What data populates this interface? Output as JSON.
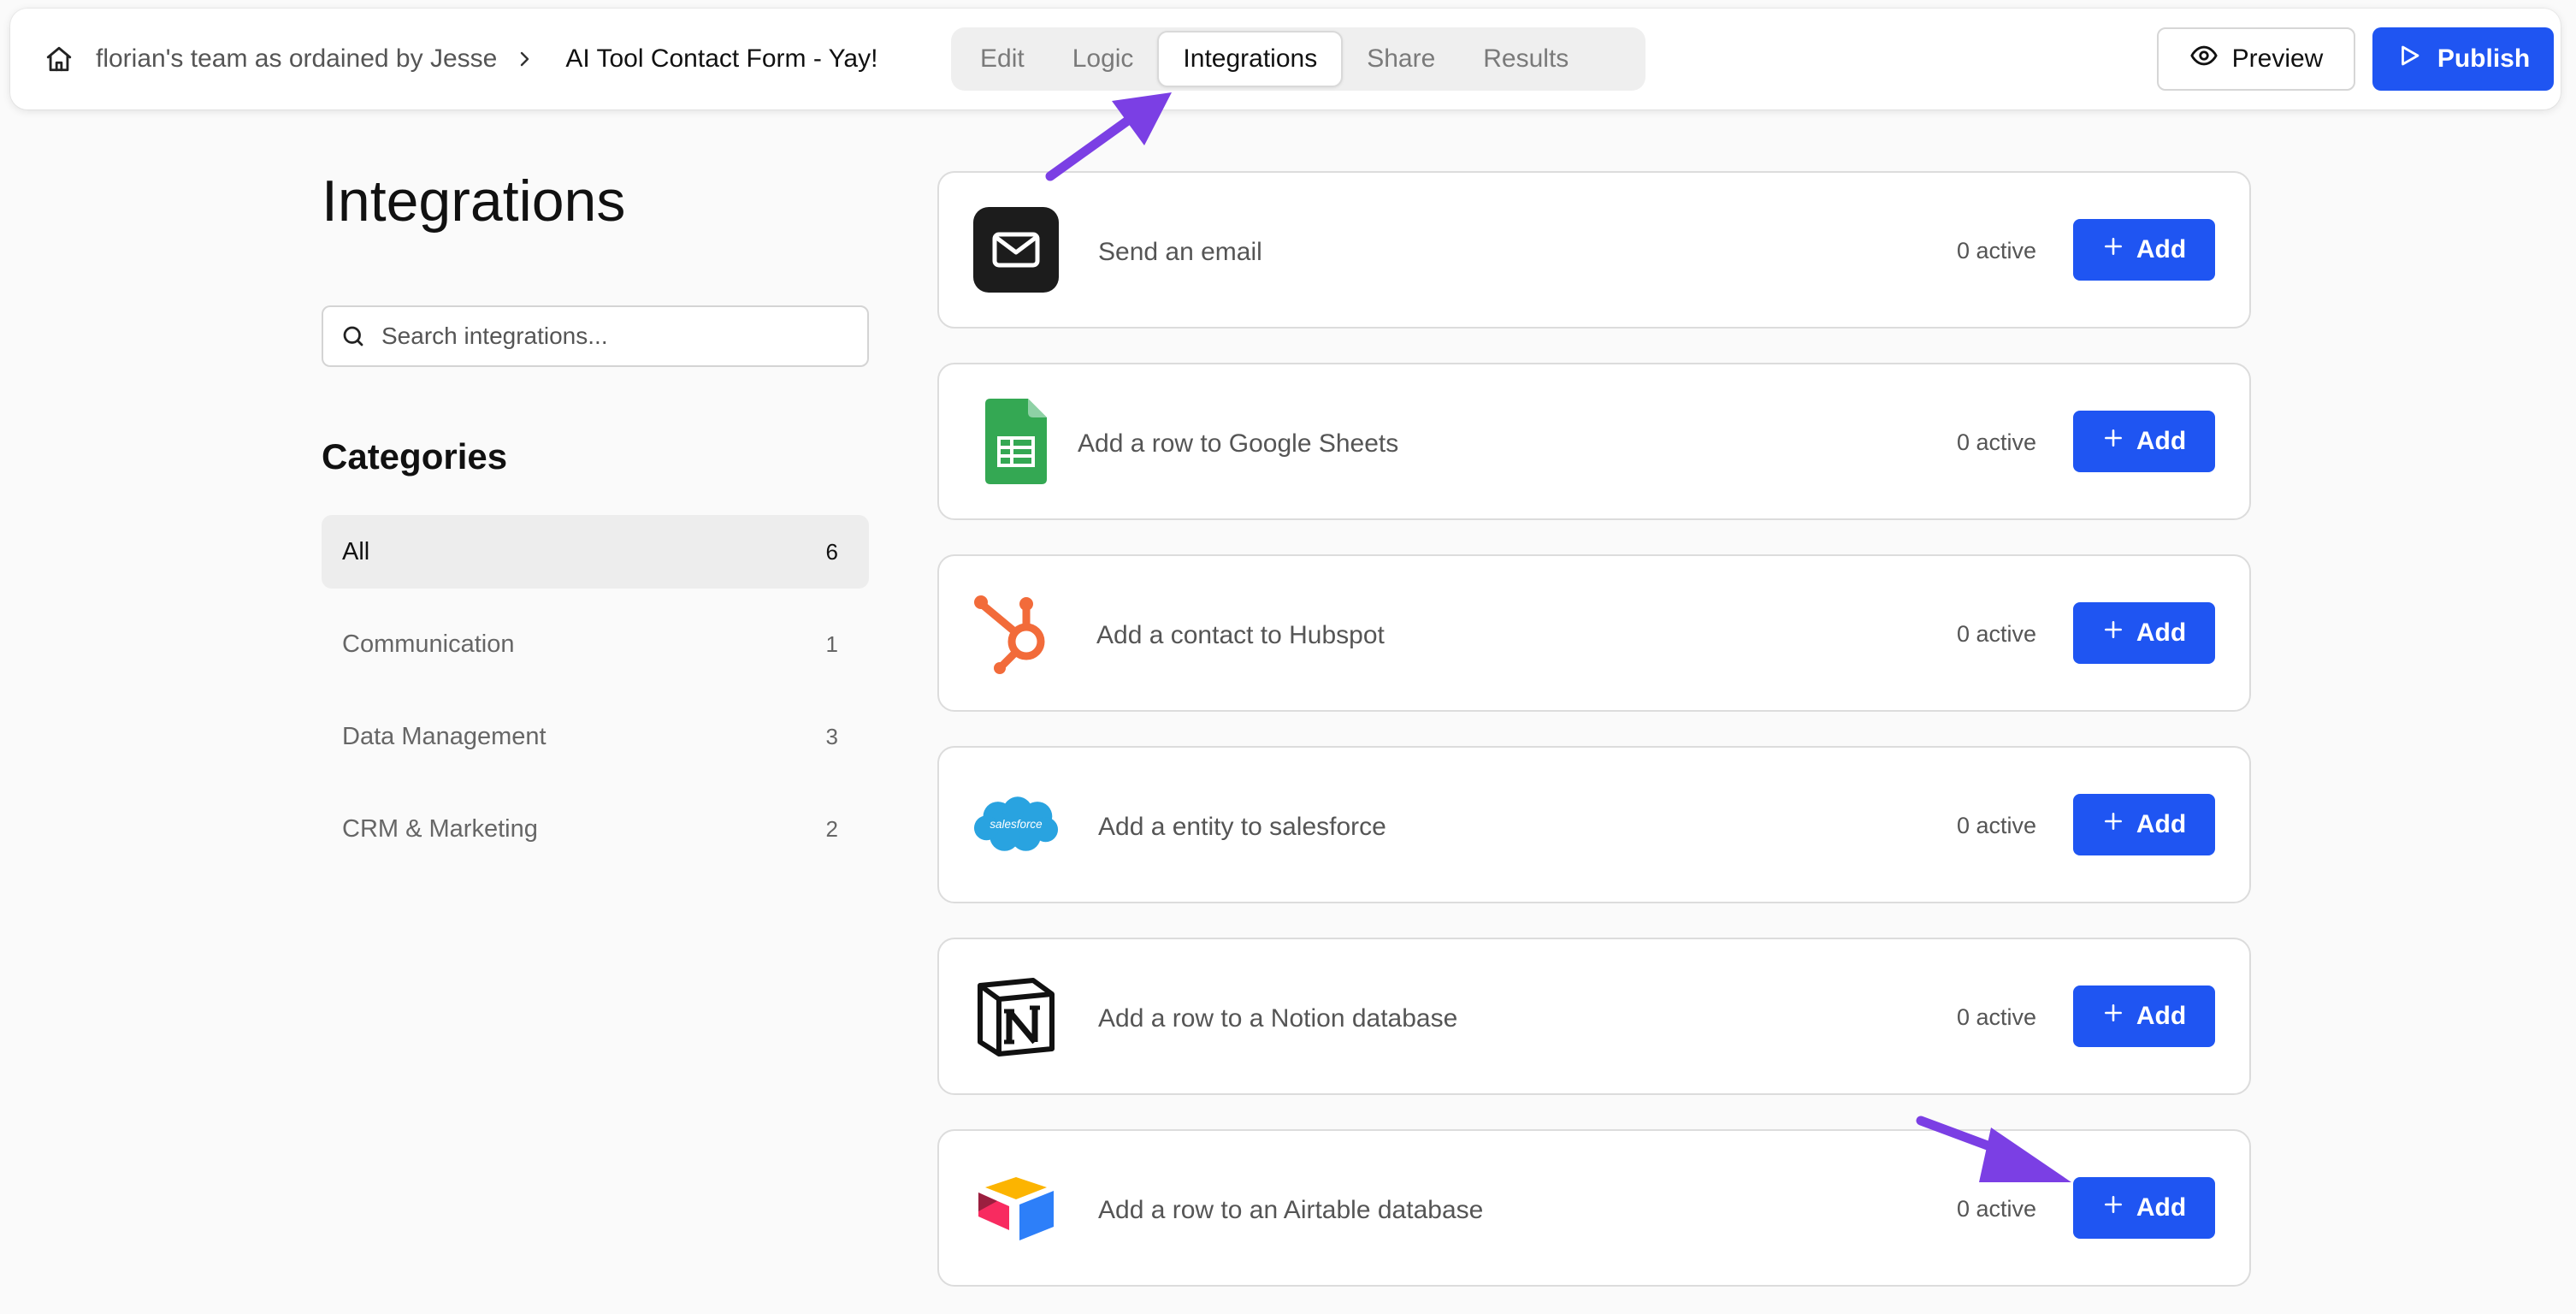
{
  "header": {
    "team_name": "florian's team as ordained by Jesse",
    "form_name": "AI Tool Contact Form - Yay!",
    "tabs": [
      {
        "label": "Edit",
        "active": false
      },
      {
        "label": "Logic",
        "active": false
      },
      {
        "label": "Integrations",
        "active": true
      },
      {
        "label": "Share",
        "active": false
      },
      {
        "label": "Results",
        "active": false
      }
    ],
    "preview_label": "Preview",
    "publish_label": "Publish"
  },
  "sidebar": {
    "title": "Integrations",
    "search_placeholder": "Search integrations...",
    "categories_heading": "Categories",
    "categories": [
      {
        "label": "All",
        "count": "6",
        "active": true
      },
      {
        "label": "Communication",
        "count": "1",
        "active": false
      },
      {
        "label": "Data Management",
        "count": "3",
        "active": false
      },
      {
        "label": "CRM & Marketing",
        "count": "2",
        "active": false
      }
    ]
  },
  "integrations": [
    {
      "label": "Send an email",
      "status": "0 active",
      "button": "Add",
      "icon": "email-icon"
    },
    {
      "label": "Add a row to Google Sheets",
      "status": "0 active",
      "button": "Add",
      "icon": "google-sheets-icon"
    },
    {
      "label": "Add a contact to Hubspot",
      "status": "0 active",
      "button": "Add",
      "icon": "hubspot-icon"
    },
    {
      "label": "Add a entity to salesforce",
      "status": "0 active",
      "button": "Add",
      "icon": "salesforce-icon"
    },
    {
      "label": "Add a row to a Notion database",
      "status": "0 active",
      "button": "Add",
      "icon": "notion-icon"
    },
    {
      "label": "Add a row to an Airtable database",
      "status": "0 active",
      "button": "Add",
      "icon": "airtable-icon"
    }
  ],
  "logo_text": {
    "salesforce": "salesforce"
  },
  "colors": {
    "accent": "#1f55f2",
    "annotation_arrow": "#7b3fe4"
  }
}
